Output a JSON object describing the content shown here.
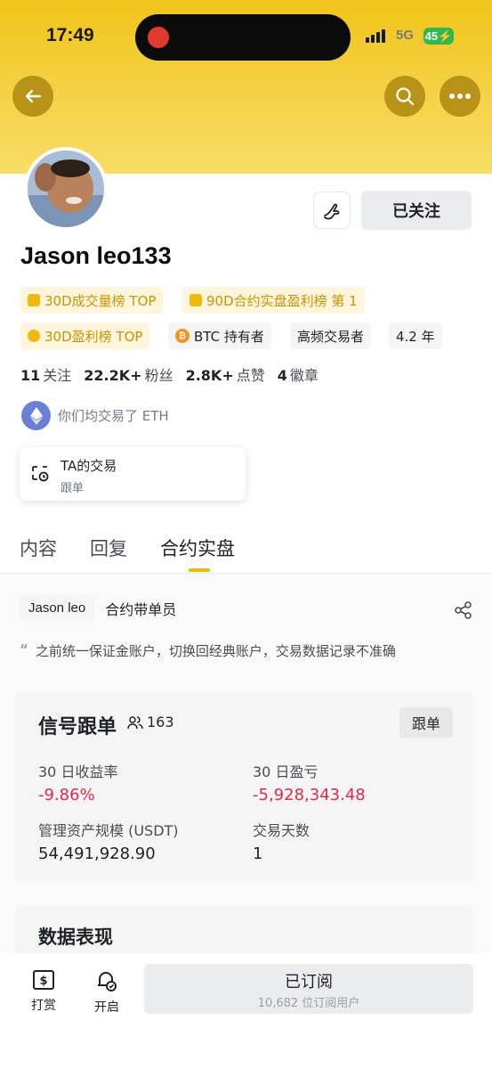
{
  "status_bar": {
    "time": "17:49",
    "network": "5G",
    "battery": "45"
  },
  "header": {
    "icons": [
      "back-arrow-icon",
      "search-icon",
      "more-dots-icon"
    ]
  },
  "profile": {
    "username": "Jason leo133",
    "follow_button": "已关注",
    "badges_row1": [
      "30D成交量榜 TOP",
      "90D合约实盘盈利榜 第 1"
    ],
    "badges_row2": [
      "30D盈利榜 TOP",
      "BTC 持有者",
      "高频交易者",
      "4.2 年"
    ],
    "stats": [
      {
        "value": "11",
        "label": "关注"
      },
      {
        "value": "22.2K+",
        "label": "粉丝"
      },
      {
        "value": "2.8K+",
        "label": "点赞"
      },
      {
        "value": "4",
        "label": "徽章"
      }
    ],
    "common_trade": "你们均交易了 ETH",
    "trade_card": {
      "title": "TA的交易",
      "subtitle": "跟单"
    }
  },
  "tabs": [
    "内容",
    "回复",
    "合约实盘"
  ],
  "active_tab": "合约实盘",
  "futures": {
    "name_chip": "Jason leo",
    "role": "合约带单员",
    "note": "之前统一保证金账户，切换回经典账户，交易数据记录不准确",
    "signal": {
      "title": "信号跟单",
      "followers": "163",
      "copy_button": "跟单",
      "metrics": [
        {
          "label": "30 日收益率",
          "value": "-9.86%"
        },
        {
          "label": "30 日盈亏",
          "value": "-5,928,343.48"
        },
        {
          "label": "管理资产规模 (USDT)",
          "value": "54,491,928.90"
        },
        {
          "label": "交易天数",
          "value": "1"
        }
      ]
    },
    "performance_title": "数据表现"
  },
  "bottom_bar": {
    "tip_label": "打赏",
    "enable_label": "开启",
    "subscribe_main": "已订阅",
    "subscribe_sub": "10,682 位订阅用户"
  },
  "colors": {
    "accent": "#f0b90b",
    "negative": "#e0294a",
    "header": "#f0c419"
  }
}
